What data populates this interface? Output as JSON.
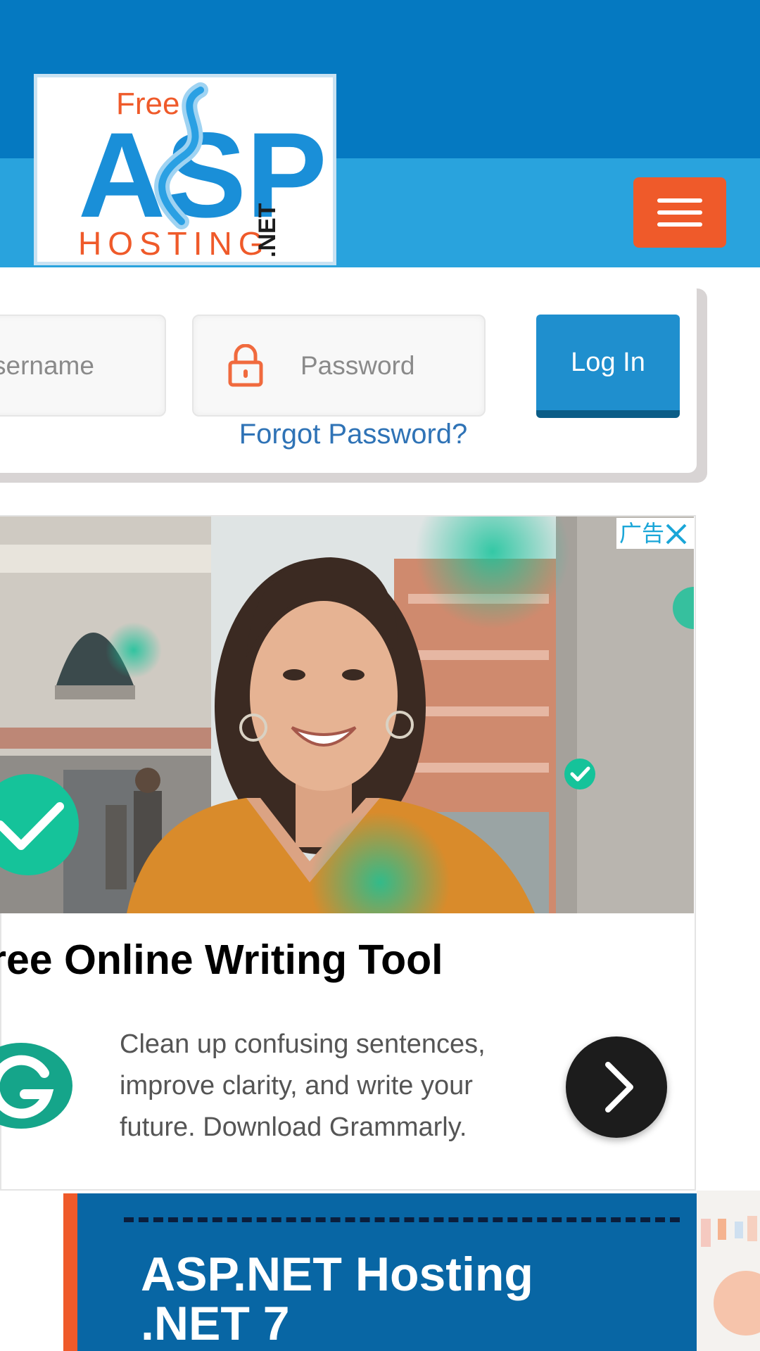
{
  "header": {
    "logo": {
      "top_word": "Free",
      "main_letters": "ASP",
      "bottom_word": "HOSTING",
      "suffix": ".NET"
    },
    "menu_icon": "hamburger-menu-icon"
  },
  "login": {
    "username_placeholder": "sername",
    "password_placeholder": "Password",
    "login_button": "Log In",
    "forgot_password": "Forgot Password?",
    "lock_icon": "lock-icon"
  },
  "ad": {
    "label": "广告",
    "close_icon": "close-icon",
    "headline": "ree Online Writing Tool",
    "body": "Clean up confusing sentences, improve clarity, and write your future. Download Grammarly.",
    "logo_icon": "grammarly-g-icon",
    "next_icon": "chevron-right-icon",
    "accent_color": "#15c39a"
  },
  "feature": {
    "title_line1": "ASP.NET Hosting",
    "title_line2": ".NET 7"
  },
  "colors": {
    "header_dark": "#0579c1",
    "header_light": "#29a3dd",
    "accent_orange": "#ef5a2a",
    "button_blue": "#1f8fce",
    "link_blue": "#2f73b6",
    "card_blue": "#0866a4"
  }
}
